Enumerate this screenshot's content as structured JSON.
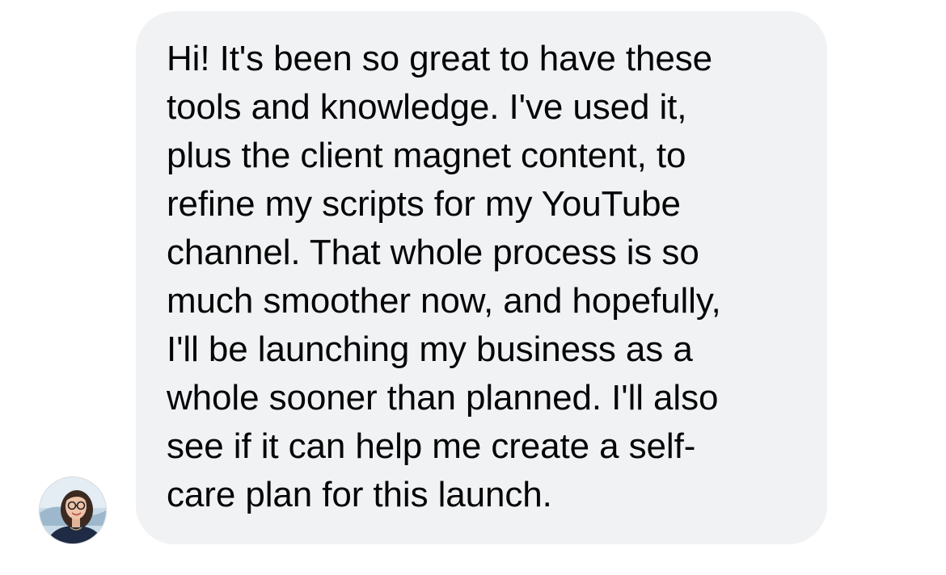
{
  "message": {
    "lines": [
      "Hi! It's been so great to have these",
      "tools and knowledge. I've used it,",
      "plus the client magnet content, to",
      "refine my scripts for my YouTube",
      "channel. That whole process is so",
      "much smoother now, and hopefully,",
      "I'll be launching my business as a",
      "whole sooner than planned. I'll also",
      "see if it can help me create a self-",
      "care plan for this launch."
    ]
  },
  "sender": {
    "avatar_icon": "profile-photo",
    "colors": {
      "bubble_background": "#f1f2f4",
      "text": "#050505"
    }
  }
}
